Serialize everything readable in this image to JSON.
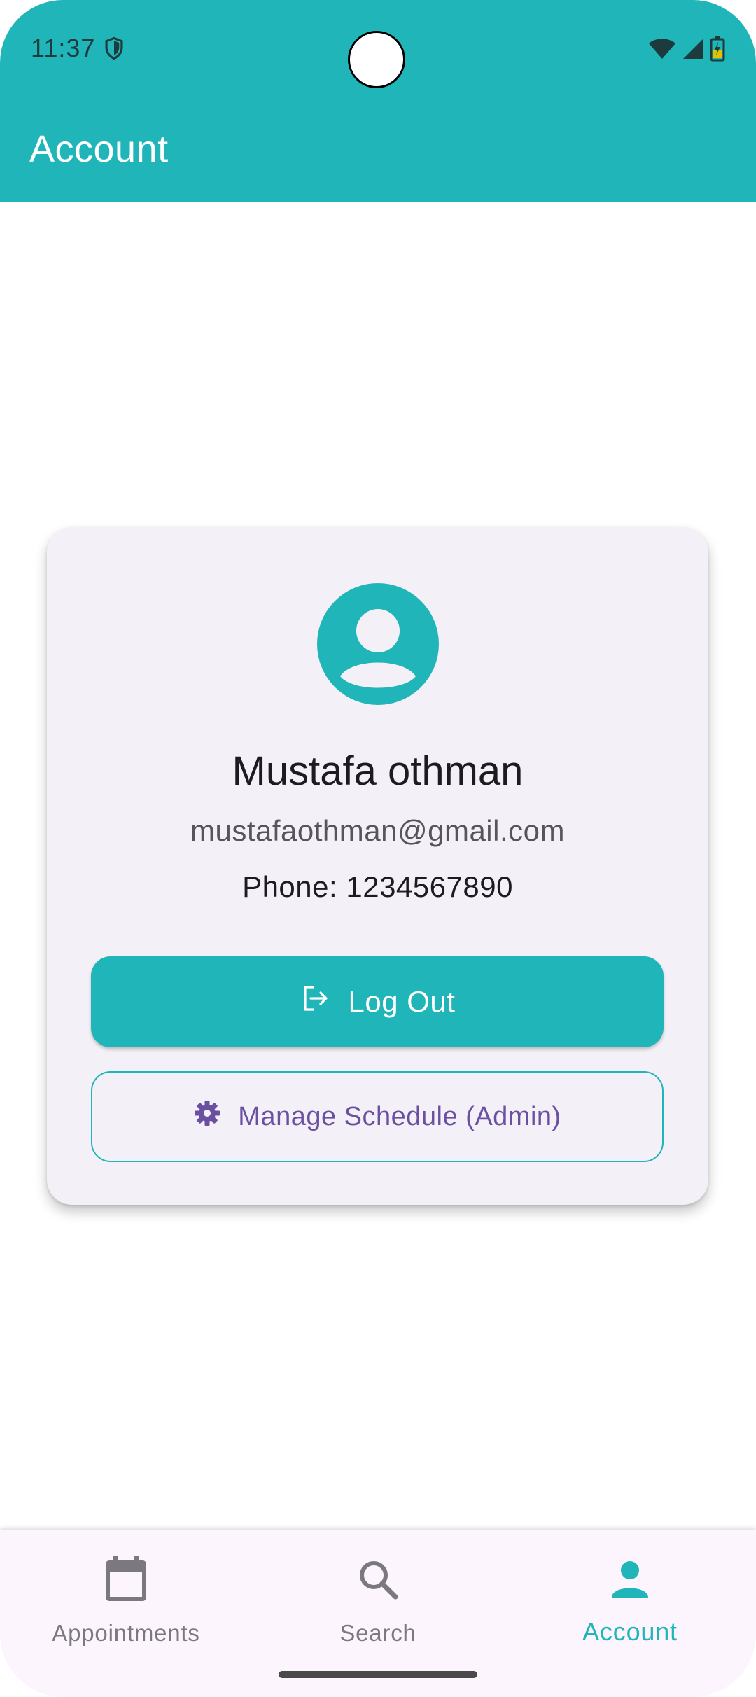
{
  "status_bar": {
    "time": "11:37"
  },
  "app_bar": {
    "title": "Account"
  },
  "profile": {
    "name": "Mustafa othman",
    "email": "mustafaothman@gmail.com",
    "phone": "Phone: 1234567890"
  },
  "actions": {
    "logout_label": "Log Out",
    "manage_schedule_label": "Manage Schedule (Admin)"
  },
  "bottom_nav": {
    "items": [
      {
        "label": "Appointments",
        "icon": "calendar-icon",
        "active": false
      },
      {
        "label": "Search",
        "icon": "search-icon",
        "active": false
      },
      {
        "label": "Account",
        "icon": "person-icon",
        "active": true
      }
    ]
  },
  "colors": {
    "primary": "#20b5b8",
    "card_background": "#f4f0f7",
    "admin_text": "#6b4fa0",
    "nav_background": "#fcf5fd"
  }
}
